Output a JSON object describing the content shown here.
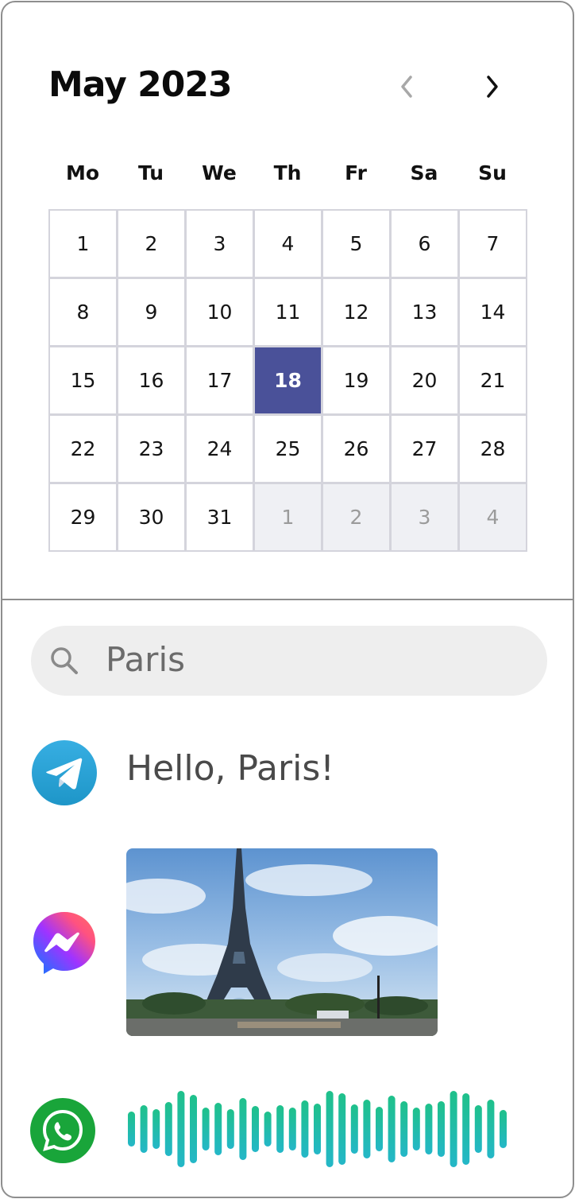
{
  "calendar": {
    "title": "May 2023",
    "prev_label": "previous month",
    "next_label": "next month",
    "weekdays": [
      "Mo",
      "Tu",
      "We",
      "Th",
      "Fr",
      "Sa",
      "Su"
    ],
    "selected_day": "18",
    "weeks": [
      [
        {
          "d": "1"
        },
        {
          "d": "2"
        },
        {
          "d": "3"
        },
        {
          "d": "4"
        },
        {
          "d": "5"
        },
        {
          "d": "6"
        },
        {
          "d": "7"
        }
      ],
      [
        {
          "d": "8"
        },
        {
          "d": "9"
        },
        {
          "d": "10"
        },
        {
          "d": "11"
        },
        {
          "d": "12"
        },
        {
          "d": "13"
        },
        {
          "d": "14"
        }
      ],
      [
        {
          "d": "15"
        },
        {
          "d": "16"
        },
        {
          "d": "17"
        },
        {
          "d": "18",
          "selected": true
        },
        {
          "d": "19"
        },
        {
          "d": "20"
        },
        {
          "d": "21"
        }
      ],
      [
        {
          "d": "22"
        },
        {
          "d": "23"
        },
        {
          "d": "24"
        },
        {
          "d": "25"
        },
        {
          "d": "26"
        },
        {
          "d": "27"
        },
        {
          "d": "28"
        }
      ],
      [
        {
          "d": "29"
        },
        {
          "d": "30"
        },
        {
          "d": "31"
        },
        {
          "d": "1",
          "other": true
        },
        {
          "d": "2",
          "other": true
        },
        {
          "d": "3",
          "other": true
        },
        {
          "d": "4",
          "other": true
        }
      ]
    ]
  },
  "search": {
    "value": "Paris",
    "icon": "search-icon"
  },
  "messages": {
    "telegram": {
      "icon": "telegram-icon",
      "text": "Hello, Paris!"
    },
    "messenger": {
      "icon": "messenger-icon",
      "attachment": "eiffel-tower-photo"
    },
    "whatsapp": {
      "icon": "whatsapp-icon",
      "attachment": "voice-message-waveform"
    }
  },
  "colors": {
    "selected_day_bg": "#4a5199",
    "search_bg": "#eeeeee",
    "telegram_blue": "#2aa3e0",
    "whatsapp_green": "#19a53a",
    "waveform": "#22c4b0"
  }
}
